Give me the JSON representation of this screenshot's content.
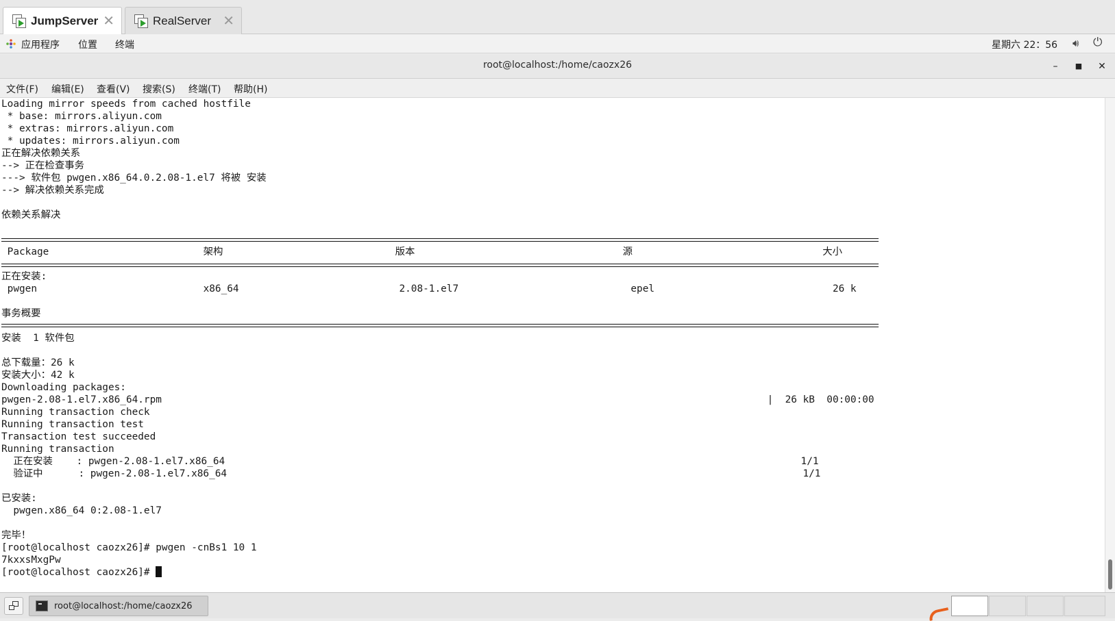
{
  "tabs": [
    {
      "label": "JumpServer",
      "active": true
    },
    {
      "label": "RealServer",
      "active": false
    }
  ],
  "panel": {
    "apps": "应用程序",
    "places": "位置",
    "terminal": "终端",
    "clock": "星期六 22：56"
  },
  "window": {
    "title": "root@localhost:/home/caozx26"
  },
  "menu": [
    "文件(F)",
    "编辑(E)",
    "查看(V)",
    "搜索(S)",
    "终端(T)",
    "帮助(H)"
  ],
  "terminal": {
    "lines": [
      "Loading mirror speeds from cached hostfile",
      " * base: mirrors.aliyun.com",
      " * extras: mirrors.aliyun.com",
      " * updates: mirrors.aliyun.com",
      "正在解决依赖关系",
      "--> 正在检查事务",
      "---> 软件包 pwgen.x86_64.0.2.08-1.el7 将被 安装",
      "--> 解决依赖关系完成",
      "",
      "依赖关系解决",
      "",
      "",
      " Package                          架构                             版本                                   源                                大小",
      "",
      "正在安装:",
      " pwgen                            x86_64                           2.08-1.el7                             epel                              26 k",
      "",
      "事务概要",
      "",
      "安装  1 软件包",
      "",
      "总下载量：26 k",
      "安装大小：42 k",
      "Downloading packages:",
      "pwgen-2.08-1.el7.x86_64.rpm                                                                                                      |  26 kB  00:00:00",
      "Running transaction check",
      "Running transaction test",
      "Transaction test succeeded",
      "Running transaction",
      "  正在安装    : pwgen-2.08-1.el7.x86_64                                                                                                 1/1",
      "  验证中      : pwgen-2.08-1.el7.x86_64                                                                                                 1/1",
      "",
      "已安装:",
      "  pwgen.x86_64 0:2.08-1.el7",
      "",
      "完毕！",
      "[root@localhost caozx26]# pwgen -cnBs1 10 1",
      "7kxxsMxgPw"
    ],
    "prompt": "[root@localhost caozx26]# "
  },
  "taskbar": {
    "task_label": "root@localhost:/home/caozx26"
  }
}
